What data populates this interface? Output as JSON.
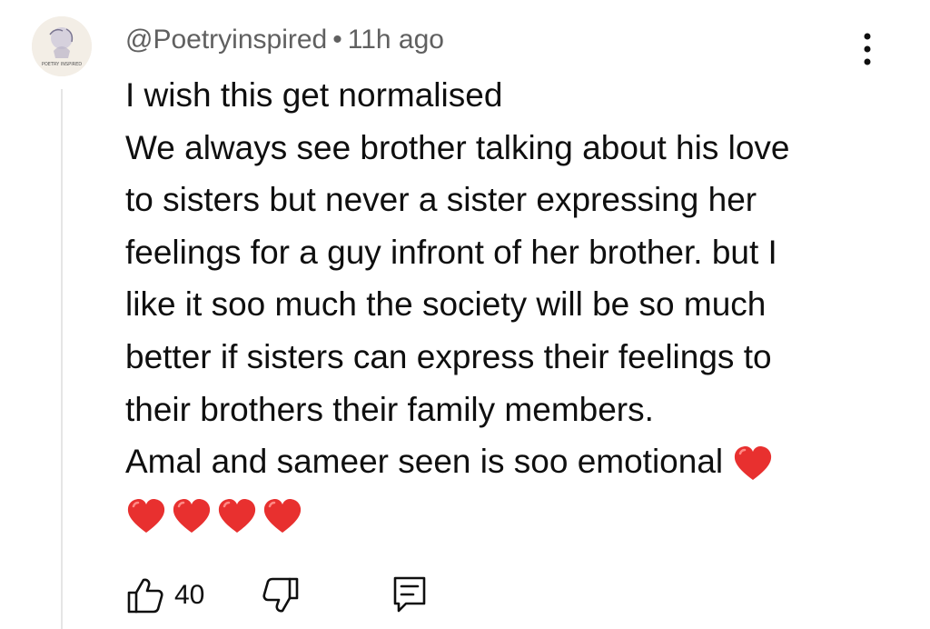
{
  "comment": {
    "author": "@Poetryinspired",
    "separator": "•",
    "time": "11h ago",
    "avatar_label": "POETRY INSPIRED",
    "lines": [
      "I wish this get normalised",
      "We always see brother talking about his love",
      "to sisters but never a sister expressing her",
      "feelings for a guy infront of her brother. but I",
      "like it soo much the society will be so much",
      "better if sisters can express their feelings to",
      "their brothers their family members.",
      "Amal and sameer seen is soo emotional"
    ],
    "hearts_inline": 1,
    "hearts_next_line": 4
  },
  "actions": {
    "like_count": "40",
    "like_icon": "thumbs-up-icon",
    "dislike_icon": "thumbs-down-icon",
    "reply_icon": "comment-reply-icon",
    "menu_icon": "more-vert-icon"
  },
  "colors": {
    "meta_text": "#606060",
    "body_text": "#0f0f0f",
    "heart": "#e8302f",
    "thread_line": "#e5e5e5"
  }
}
